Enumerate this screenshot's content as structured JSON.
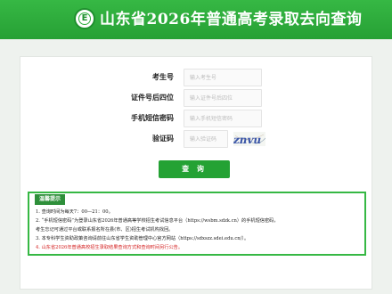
{
  "header": {
    "title": "山东省2026年普通高考录取去向查询",
    "logo_text": "E",
    "logo_icon": "exam-authority-logo-icon"
  },
  "form": {
    "fields": [
      {
        "label": "考生号",
        "placeholder": "输入考生号"
      },
      {
        "label": "证件号后四位",
        "placeholder": "输入证件号后四位"
      },
      {
        "label": "手机短信密码",
        "placeholder": "输入手机短信密码"
      },
      {
        "label": "验证码",
        "placeholder": "输入验证码"
      }
    ],
    "captcha_text": "znvu",
    "submit_label": "查 询"
  },
  "notice": {
    "title": "温馨提示",
    "lines": [
      "1. 查询时间为每天7：00—21：00。",
      "2. “手机短信密码”为登录山东省2026年普通高等学校招生考试信息平台（https://wsbm.sdzk.cn）的手机短信密码，",
      "考生忘记可通过平台或联系报名所在县(市、区)招生考试机构找回。",
      "3. 本专科学生资助政策咨询请前往山东省学生资助管理中心官方网站（https://sdxszz.sdei.edu.cn/）。",
      "4. 山东省2026年普通高校招生录取结果查询方式和查询时间另行公告。"
    ]
  }
}
